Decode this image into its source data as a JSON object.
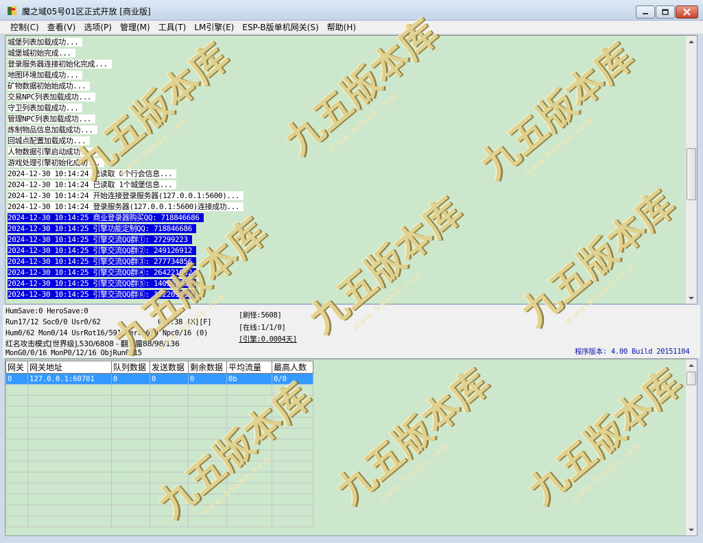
{
  "window": {
    "title": "魔之域05号01区正式开放 [商业版]",
    "buttons": {
      "minimize": "minimize-icon",
      "maximize": "maximize-icon",
      "close": "close-icon"
    }
  },
  "menu": {
    "items": [
      "控制(C)",
      "查看(V)",
      "选项(P)",
      "管理(M)",
      "工具(T)",
      "LM引擎(E)",
      "ESP-B版单机网关(S)",
      "帮助(H)"
    ]
  },
  "log": {
    "lines": [
      "城堡列表加载成功...",
      "城堡城初始完成...",
      "登录服务器连接初始化完成...",
      "地图环境加载成功...",
      "矿物数据初始始成功...",
      "交易NPC列表加载成功...",
      "守卫列表加载成功...",
      "管理NPC列表加载成功...",
      "炼制物品信息加载成功...",
      "回城点配置加载成功...",
      "人物数据引擎启动成功...",
      "游戏处理引擎初始化成功...",
      "2024-12-30 10:14:24 已读取 0个行会信息...",
      "2024-12-30 10:14:24 已读取 1个城堡信息...",
      "2024-12-30 10:14:24 开始连接登录服务器(127.0.0.1:5600)...",
      "2024-12-30 10:14:24 登录服务器(127.0.0.1:5600)连接成功..."
    ],
    "selected_lines": [
      "2024-12-30 10:14:25 商业登录器购买QQ: 718846686",
      "2024-12-30 10:14:25 引擎功能定制QQ: 718846686",
      "2024-12-30 10:14:25 引擎交流QQ群①: 27299223",
      "2024-12-30 10:14:25 引擎交流QQ群②: 249126912",
      "2024-12-30 10:14:25 引擎交流QQ群③: 277734856",
      "2024-12-30 10:14:25 引擎交流QQ群④: 264221952",
      "2024-12-30 10:14:25 引擎交流QQ群⑤: 140598634",
      "2024-12-30 10:14:25 引擎交流QQ群⑥: 122209510"
    ]
  },
  "status": {
    "line1": "HumSave:0 HeroSave:0",
    "line2a": "Run17/12 Soc0/0 Usr0/62",
    "line2b": "0:0:38 [M][F]",
    "line3": "Hum0/62 Mon0/14 UsrRot16/591 Merch0/0 Npc0/16 (0)",
    "line4": "红名攻击模式[世界级],530/6808 - 翻江蜃88/98/136",
    "line5": "MonG0/0/16 MonP0/12/16 ObjRun0/15",
    "refresh": "[刷怪:5608]",
    "online": "[在线:1/1/0]",
    "engine": "[引擎:0.0004天]",
    "version": "程序版本: 4.00 Build 20151104"
  },
  "grid": {
    "headers": [
      "网关",
      "网关地址",
      "队列数据",
      "发送数据",
      "剩余数据",
      "平均流量",
      "最高人数"
    ],
    "rows": [
      [
        "0",
        "127.0.0.1:60701",
        "0",
        "0",
        "0",
        "0b",
        "0/0"
      ]
    ]
  },
  "watermark": {
    "text": "九五版本库",
    "url": "www.95bbk.com"
  }
}
